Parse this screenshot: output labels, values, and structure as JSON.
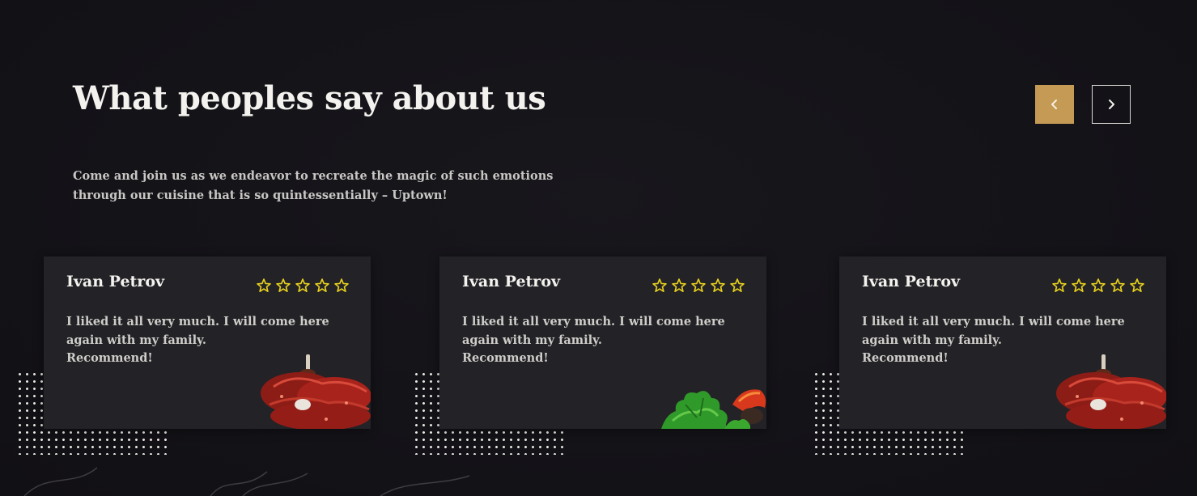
{
  "section": {
    "title": "What peoples say about us",
    "subtitle": "Come and join us as we endeavor to recreate the magic of such emotions through our cuisine that is so quintessentially – Uptown!"
  },
  "nav": {
    "prev_icon": "chevron-left-icon",
    "next_icon": "chevron-right-icon"
  },
  "colors": {
    "accent": "#c49a55",
    "star": "#e6cf1e",
    "card_bg": "#232226",
    "page_bg": "#141317"
  },
  "testimonials": [
    {
      "name": "Ivan Petrov",
      "rating": 5,
      "text": "I liked it all very much. I will come here again with my family.\nRecommend!",
      "image": "dried-tomato-icon"
    },
    {
      "name": "Ivan Petrov",
      "rating": 5,
      "text": "I liked it all very much. I will come here again with my family.\nRecommend!",
      "image": "parsley-pepper-icon"
    },
    {
      "name": "Ivan Petrov",
      "rating": 5,
      "text": "I liked it all very much. I will come here again with my family.\nRecommend!",
      "image": "dried-tomato-icon"
    }
  ]
}
